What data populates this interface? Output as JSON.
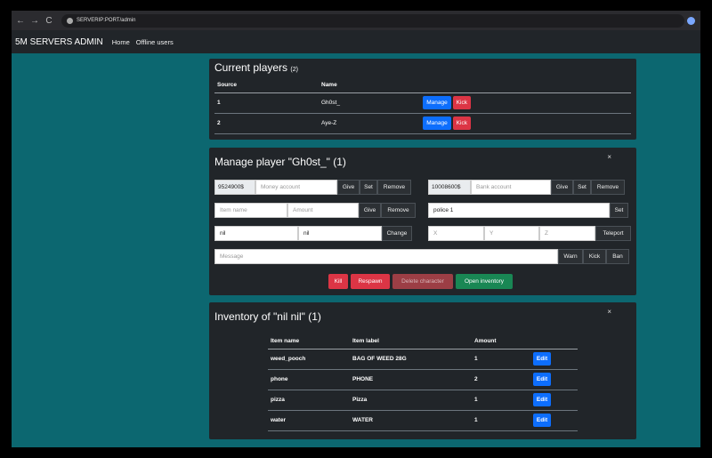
{
  "browser": {
    "back": "←",
    "forward": "→",
    "reload": "C",
    "url": "SERVERIP:PORT/admin"
  },
  "nav": {
    "brand": "5M SERVERS ADMIN",
    "links": [
      "Home",
      "Offline users"
    ]
  },
  "players": {
    "title": "Current players",
    "count": "(2)",
    "headers": [
      "Source",
      "Name"
    ],
    "rows": [
      {
        "source": "1",
        "name": "Gh0st_",
        "manage": "Manage",
        "kick": "Kick"
      },
      {
        "source": "2",
        "name": "Aye-Z",
        "manage": "Manage",
        "kick": "Kick"
      }
    ]
  },
  "manage": {
    "title": "Manage player \"Gh0st_\" (1)",
    "close": "×",
    "money": {
      "value": "9524900$",
      "placeholder": "Money account",
      "give": "Give",
      "set": "Set",
      "remove": "Remove"
    },
    "bank": {
      "value": "10008600$",
      "placeholder": "Bank account",
      "give": "Give",
      "set": "Set",
      "remove": "Remove"
    },
    "item": {
      "name_placeholder": "Item name",
      "amount_placeholder": "Amount",
      "give": "Give",
      "remove": "Remove"
    },
    "job": {
      "value": "police 1",
      "set": "Set"
    },
    "char": {
      "first": "nil",
      "last": "nil",
      "change": "Change"
    },
    "teleport": {
      "x": "X",
      "y": "Y",
      "z": "Z",
      "button": "Teleport"
    },
    "message": {
      "placeholder": "Message",
      "warn": "Warn",
      "kick": "Kick",
      "ban": "Ban"
    },
    "actions": {
      "kill": "Kill",
      "respawn": "Respawn",
      "delete": "Delete character",
      "inventory": "Open inventory"
    }
  },
  "inventory": {
    "title": "Inventory of \"nil nil\" (1)",
    "close": "×",
    "headers": [
      "Item name",
      "Item label",
      "Amount"
    ],
    "rows": [
      {
        "name": "weed_pooch",
        "label": "BAG OF WEED 28G",
        "amount": "1",
        "edit": "Edit"
      },
      {
        "name": "phone",
        "label": "PHONE",
        "amount": "2",
        "edit": "Edit"
      },
      {
        "name": "pizza",
        "label": "Pizza",
        "amount": "1",
        "edit": "Edit"
      },
      {
        "name": "water",
        "label": "WATER",
        "amount": "1",
        "edit": "Edit"
      }
    ]
  },
  "colors": {
    "background": "#0c6770",
    "card": "#212529",
    "primary": "#0d6efd",
    "danger": "#dc3545",
    "success": "#198754"
  }
}
